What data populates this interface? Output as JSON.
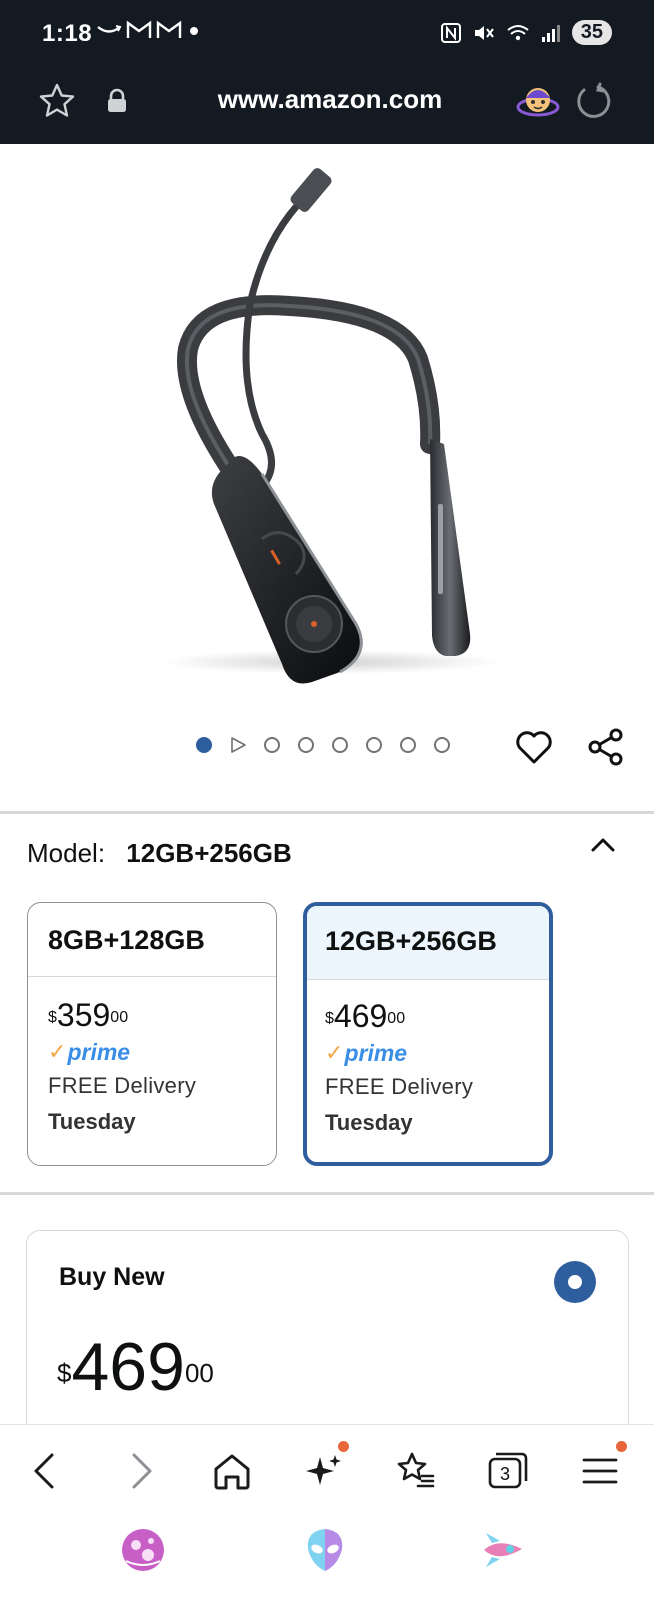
{
  "status_bar": {
    "time": "1:18",
    "battery": "35",
    "notification_icons": [
      "amazon-smile-icon",
      "gmail-icon",
      "gmail-icon",
      "dot-icon"
    ],
    "system_icons": [
      "nfc-icon",
      "mute-icon",
      "wifi-icon",
      "signal-icon"
    ]
  },
  "browser": {
    "url": "www.amazon.com"
  },
  "product": {
    "image_alt": "black neckband device",
    "carousel": {
      "total": 8,
      "active_index": 0,
      "video_index": 1
    }
  },
  "variants": {
    "label": "Model:",
    "selected_value": "12GB+256GB",
    "options": [
      {
        "name": "8GB+128GB",
        "currency": "$",
        "price_whole": "359",
        "price_cents": "00",
        "prime": "prime",
        "delivery": "FREE Delivery",
        "day": "Tuesday",
        "selected": false
      },
      {
        "name": "12GB+256GB",
        "currency": "$",
        "price_whole": "469",
        "price_cents": "00",
        "prime": "prime",
        "delivery": "FREE Delivery",
        "day": "Tuesday",
        "selected": true
      }
    ]
  },
  "buy_box": {
    "title": "Buy New",
    "currency": "$",
    "price_whole": "469",
    "price_cents": "00",
    "selected": true
  },
  "bottom_nav": {
    "tab_count": "3",
    "items": [
      "back-icon",
      "forward-icon",
      "home-icon",
      "ai-sparkle-icon",
      "bookmarks-icon",
      "tabs-icon",
      "menu-icon"
    ]
  },
  "colors": {
    "topbar": "#131a22",
    "accent_blue": "#2f5e9e",
    "prime_blue": "#3a8ee6",
    "prime_orange": "#f3a847",
    "badge_orange": "#e8663a"
  }
}
